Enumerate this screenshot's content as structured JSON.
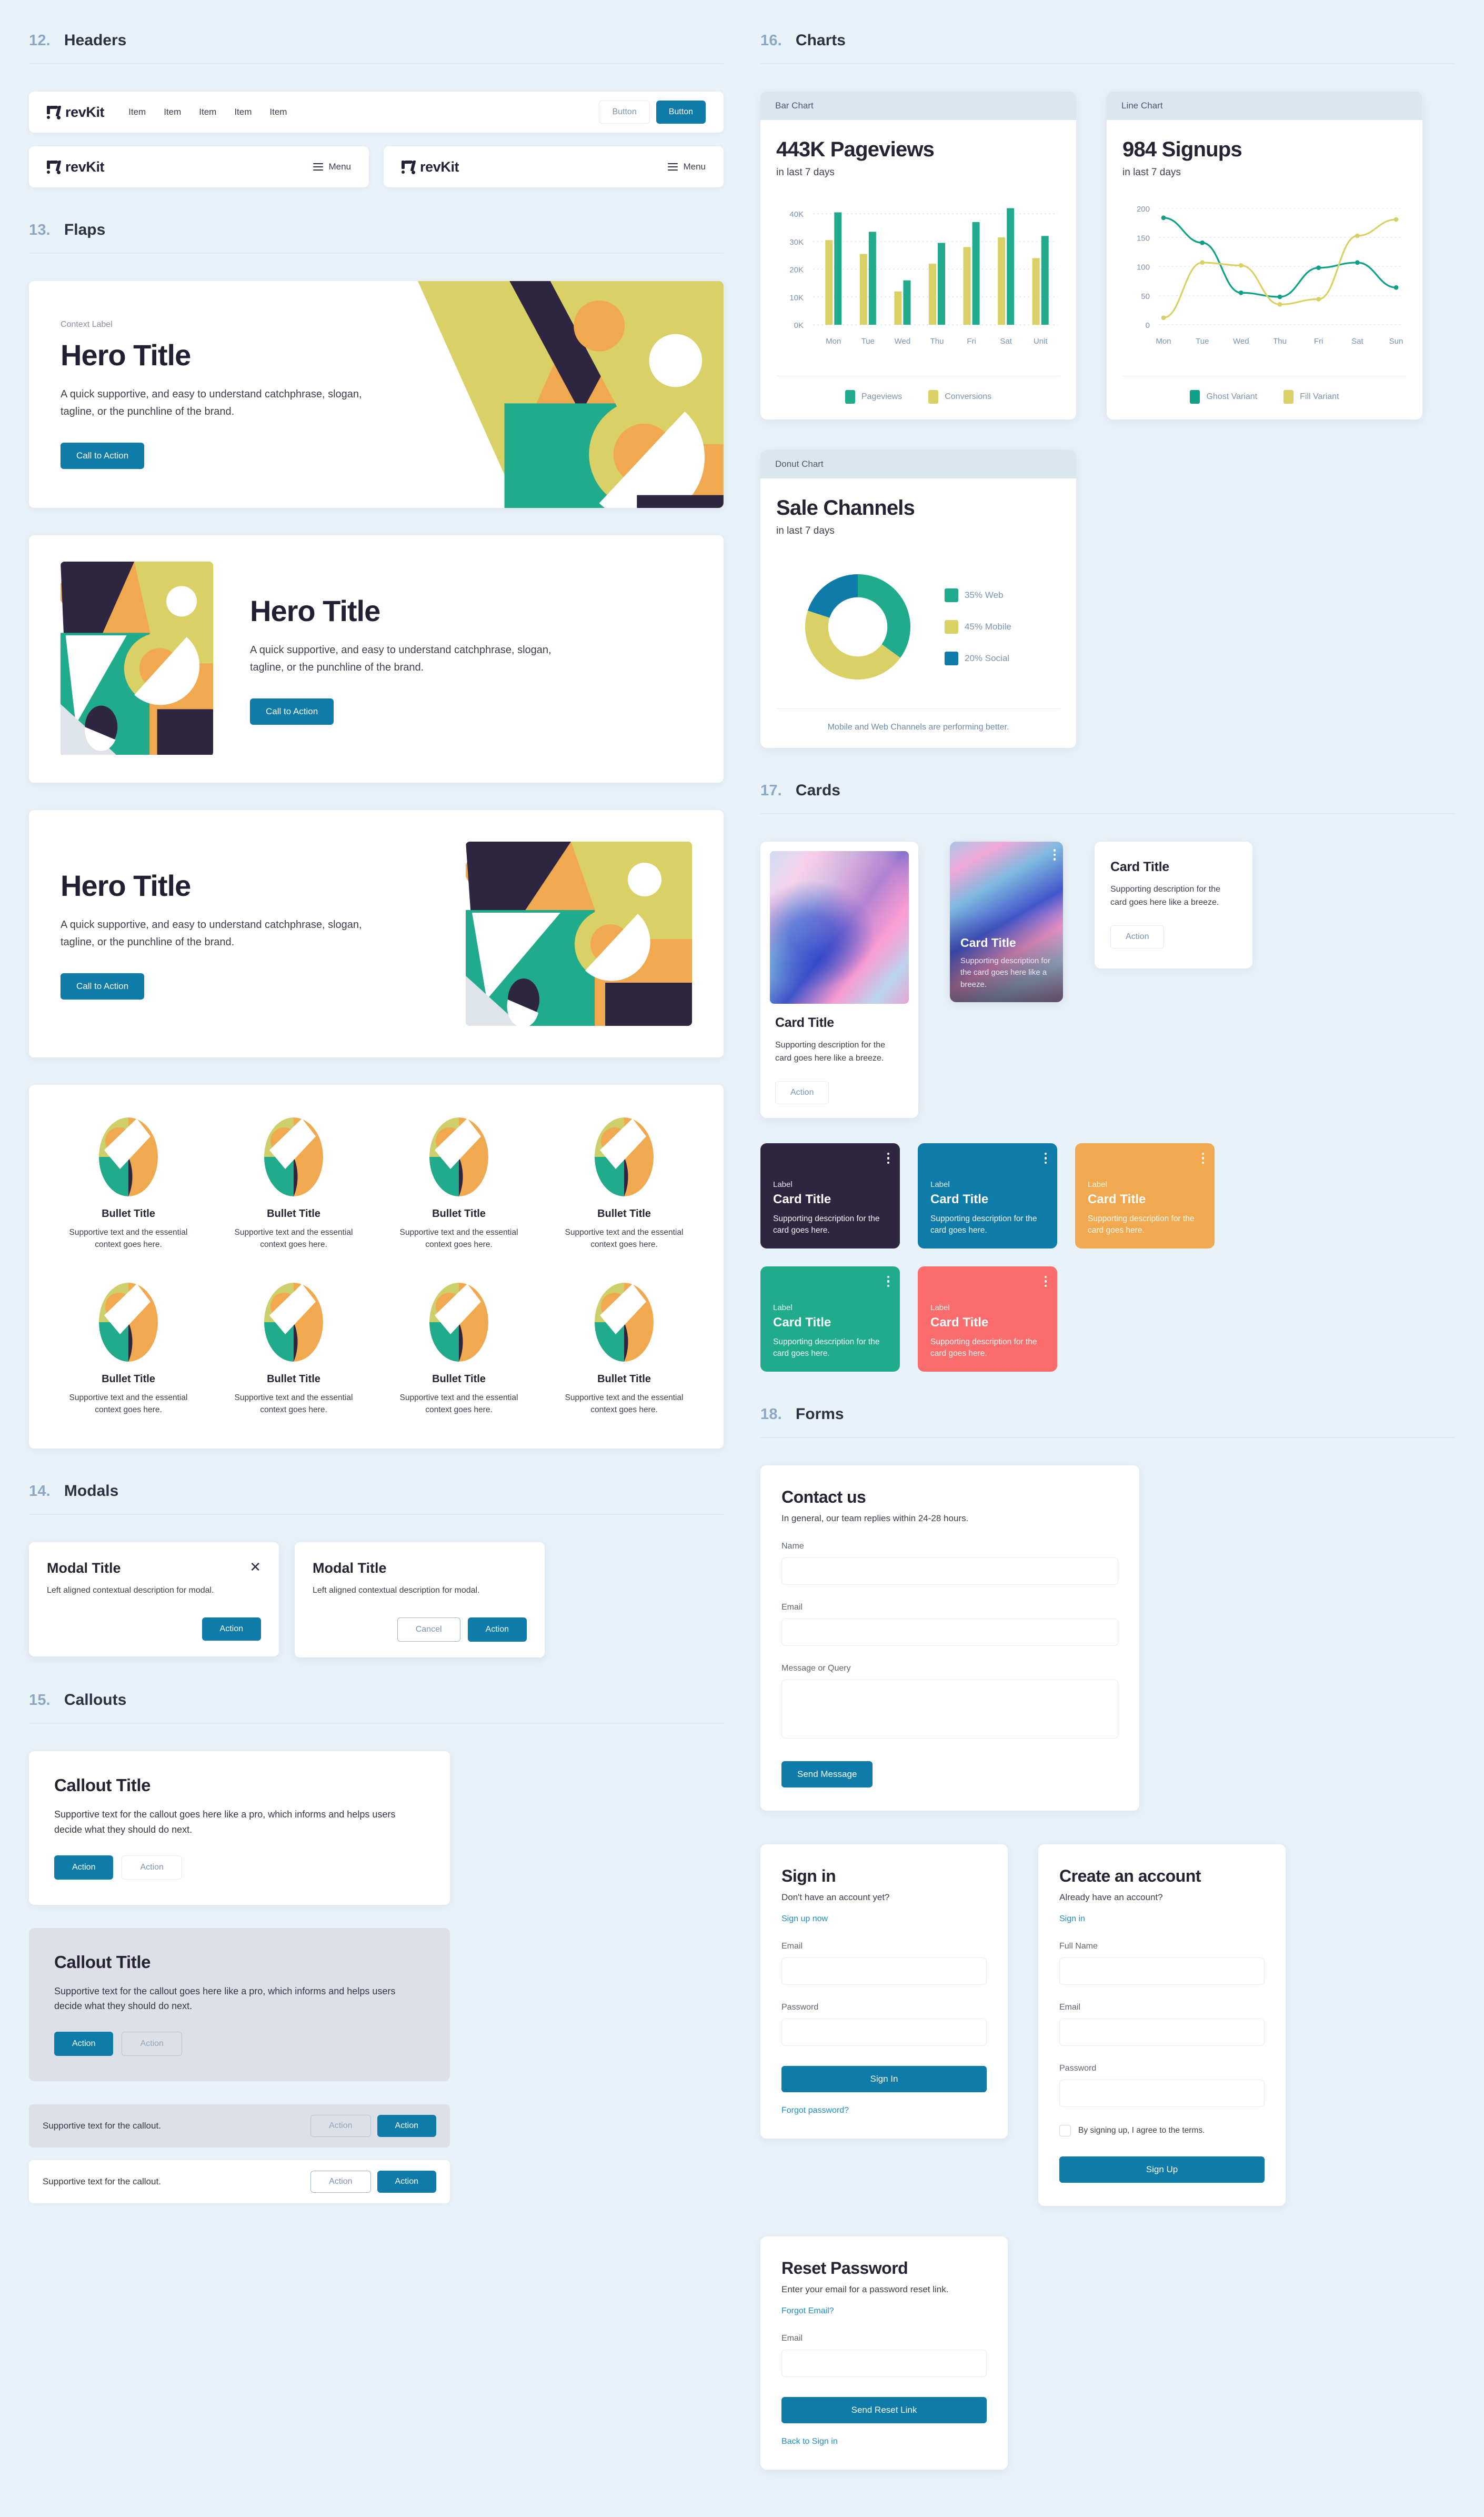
{
  "sections": {
    "headers": {
      "num": "12.",
      "title": "Headers"
    },
    "flaps": {
      "num": "13.",
      "title": "Flaps"
    },
    "modals": {
      "num": "14.",
      "title": "Modals"
    },
    "callouts": {
      "num": "15.",
      "title": "Callouts"
    },
    "charts": {
      "num": "16.",
      "title": "Charts"
    },
    "cards": {
      "num": "17.",
      "title": "Cards"
    },
    "forms": {
      "num": "18.",
      "title": "Forms"
    }
  },
  "brand": {
    "name": "revKit",
    "accent": "#0e7ba8"
  },
  "header": {
    "nav_items": [
      "Item",
      "Item",
      "Item",
      "Item",
      "Item"
    ],
    "btn_ghost": "Button",
    "btn_primary": "Button",
    "menu_label": "Menu"
  },
  "flaps": {
    "context_label": "Context Label",
    "title": "Hero Title",
    "subtitle": "A quick supportive, and easy to understand catchphrase, slogan, tagline, or the punchline of the brand.",
    "cta": "Call to Action"
  },
  "bullets": {
    "title": "Bullet Title",
    "text": "Supportive text and the essential context goes here.",
    "count": 8
  },
  "modals": {
    "title": "Modal Title",
    "desc": "Left aligned contextual description for modal.",
    "action": "Action",
    "cancel": "Cancel",
    "close": "✕"
  },
  "callouts": {
    "title": "Callout Title",
    "text": "Supportive text for the callout goes here like a pro, which informs and helps users decide what they should do next.",
    "action_primary": "Action",
    "action_secondary": "Action",
    "bar_text": "Supportive text for the callout."
  },
  "chart_data": [
    {
      "type": "bar",
      "tab": "Bar Chart",
      "title": "443K Pageviews",
      "subtitle": "in last 7 days",
      "categories": [
        "Mon",
        "Tue",
        "Wed",
        "Thu",
        "Fri",
        "Sat",
        "Unit"
      ],
      "series": [
        {
          "name": "Conversions",
          "color": "#d9d166",
          "values": [
            30500,
            25500,
            12000,
            22000,
            28000,
            31500,
            24000
          ]
        },
        {
          "name": "Pageviews",
          "color": "#20ab8c",
          "values": [
            40500,
            33500,
            16000,
            29500,
            37000,
            42000,
            32000
          ]
        }
      ],
      "ylabel": "",
      "xlabel": "",
      "yticks": [
        "0K",
        "10K",
        "20K",
        "30K",
        "40K"
      ],
      "ylim": [
        0,
        44000
      ],
      "grid": true,
      "legend": [
        "Pageviews",
        "Conversions"
      ],
      "legend_position": "bottom"
    },
    {
      "type": "line",
      "tab": "Line Chart",
      "title": "984 Signups",
      "subtitle": "in last 7 days",
      "x": [
        "Mon",
        "Tue",
        "Wed",
        "Thu",
        "Fri",
        "Sat",
        "Sun"
      ],
      "series": [
        {
          "name": "Ghost Variant",
          "color": "#0fa188",
          "values": [
            184,
            141,
            55,
            48,
            98,
            107,
            64
          ]
        },
        {
          "name": "Fill Variant",
          "color": "#d9d166",
          "values": [
            12,
            107,
            102,
            35,
            44,
            153,
            181
          ]
        }
      ],
      "yticks": [
        "0",
        "50",
        "100",
        "150",
        "200"
      ],
      "ylim": [
        0,
        210
      ],
      "grid": true,
      "legend": [
        "Ghost Variant",
        "Fill Variant"
      ],
      "legend_position": "bottom"
    },
    {
      "type": "pie",
      "tab": "Donut Chart",
      "title": "Sale Channels",
      "subtitle": "in last 7 days",
      "labels": [
        "35% Web",
        "45% Mobile",
        "20% Social"
      ],
      "values": [
        35,
        45,
        20
      ],
      "colors": [
        "#20ab8c",
        "#d9d166",
        "#0e7ba8"
      ],
      "note": "Mobile and Web Channels are performing better.",
      "legend_position": "right"
    }
  ],
  "cards": {
    "title": "Card Title",
    "desc": "Supporting description for the card goes here like a breeze.",
    "action": "Action",
    "label": "Label",
    "short_desc": "Supporting description for the card goes here.",
    "colored": [
      {
        "bg": "#2e2640"
      },
      {
        "bg": "#0e7ba8"
      },
      {
        "bg": "#f0a94e"
      },
      {
        "bg": "#20ab8c"
      },
      {
        "bg": "#fb6c6c"
      }
    ]
  },
  "forms": {
    "contact": {
      "title": "Contact us",
      "subtitle": "In general, our team replies within 24-28 hours.",
      "name_label": "Name",
      "email_label": "Email",
      "message_label": "Message or Query",
      "submit": "Send Message"
    },
    "signin": {
      "title": "Sign in",
      "prompt": "Don't have an account yet?",
      "link": "Sign up now",
      "email_label": "Email",
      "password_label": "Password",
      "submit": "Sign In",
      "forgot": "Forgot password?"
    },
    "signup": {
      "title": "Create an account",
      "prompt": "Already have an account?",
      "link": "Sign in",
      "name_label": "Full Name",
      "email_label": "Email",
      "password_label": "Password",
      "terms": "By signing up, I agree to the terms.",
      "submit": "Sign Up"
    },
    "reset": {
      "title": "Reset Password",
      "subtitle": "Enter your email for a password reset link.",
      "link": "Forgot Email?",
      "email_label": "Email",
      "submit": "Send Reset Link",
      "back": "Back to Sign in"
    }
  }
}
